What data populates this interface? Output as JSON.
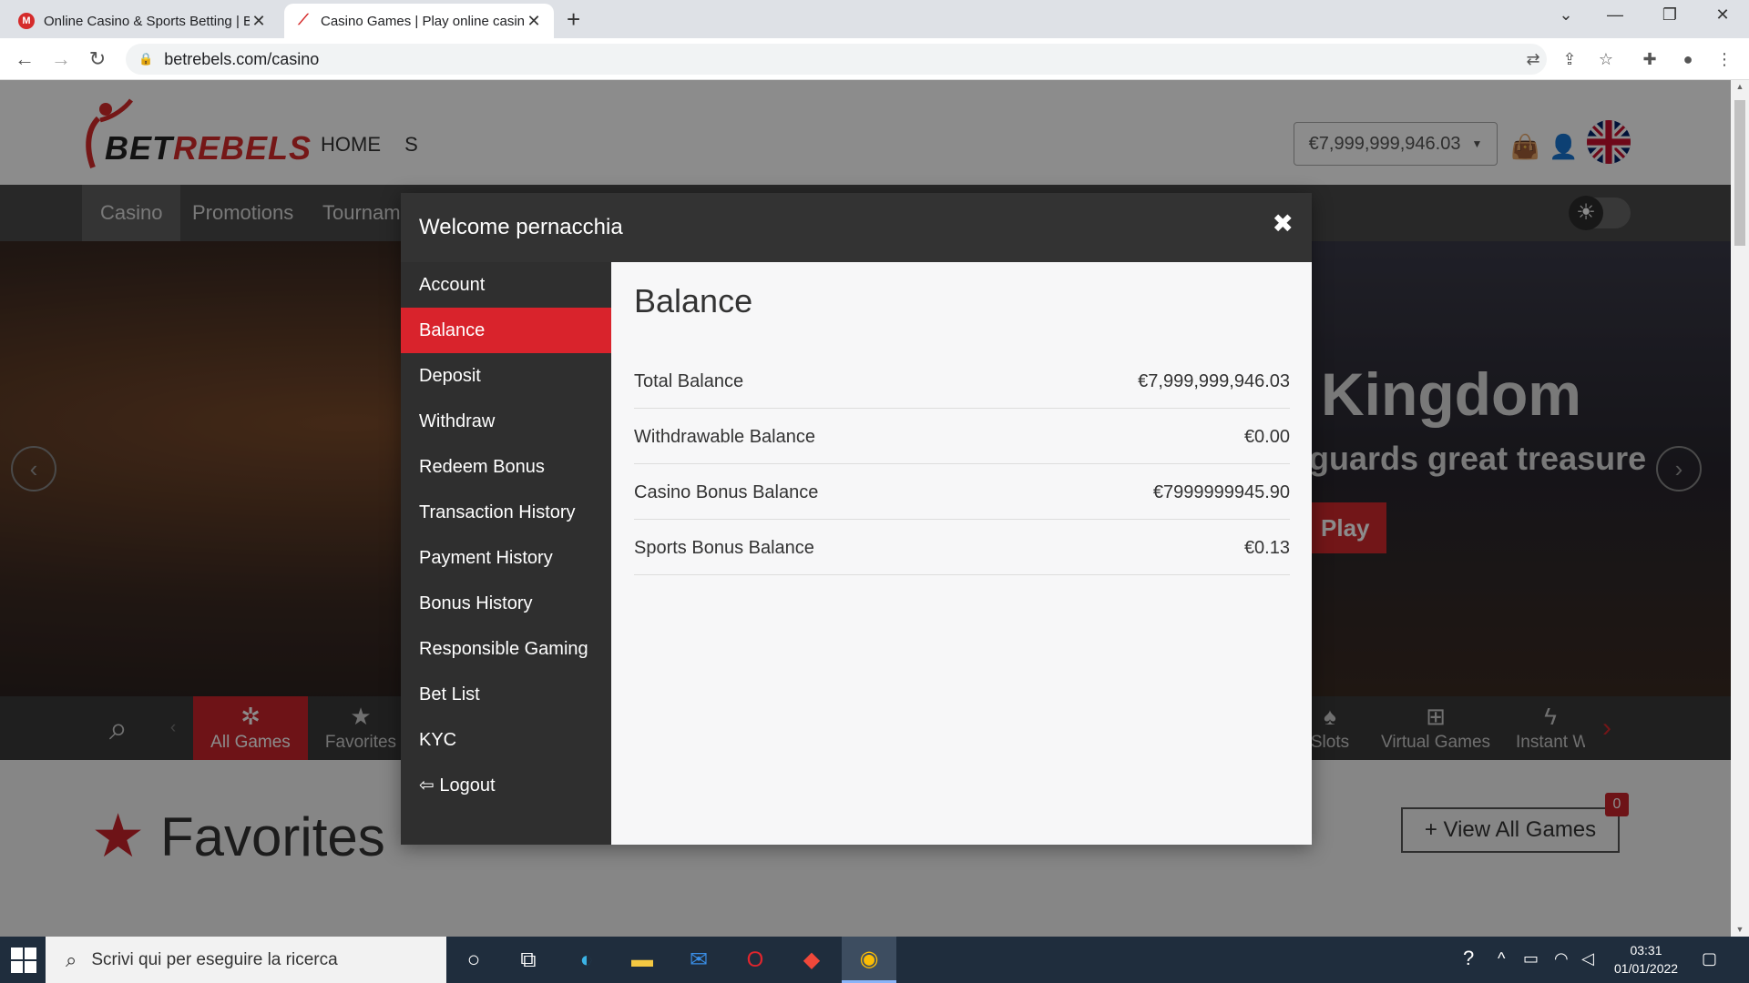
{
  "browser": {
    "tabs": [
      {
        "title": "Online Casino & Sports Betting | BetRebels",
        "active": false
      },
      {
        "title": "Casino Games | Play online casino",
        "active": true
      }
    ],
    "url": "betrebels.com/casino"
  },
  "site": {
    "logo_text_left": "BET",
    "logo_text_right": "REBELS",
    "top_nav": [
      "HOME",
      "S"
    ],
    "balance_pill": "€7,999,999,946.03",
    "subnav": [
      "Casino",
      "Promotions",
      "Tournaments"
    ],
    "hero": {
      "title": "Kingdom",
      "subtitle": "guards great treasure",
      "button": "Play"
    },
    "gamebar": [
      {
        "label": "All Games",
        "icon": "chip-icon"
      },
      {
        "label": "Favorites",
        "icon": "star-icon"
      },
      {
        "label": "Slots",
        "icon": "slots-icon"
      },
      {
        "label": "Virtual Games",
        "icon": "virtual-games-icon"
      },
      {
        "label": "Instant W",
        "icon": "lightning-icon"
      }
    ],
    "favorites_title": "Favorites",
    "view_all_button": "+ View All Games",
    "favorites_count": "0"
  },
  "modal": {
    "title": "Welcome pernacchia",
    "menu": [
      "Account",
      "Balance",
      "Deposit",
      "Withdraw",
      "Redeem Bonus",
      "Transaction History",
      "Payment History",
      "Bonus History",
      "Responsible Gaming",
      "Bet List",
      "KYC",
      "Logout"
    ],
    "active_menu": "Balance",
    "body_title": "Balance",
    "balances": [
      {
        "label": "Total Balance",
        "value": "€7,999,999,946.03"
      },
      {
        "label": "Withdrawable Balance",
        "value": "€0.00"
      },
      {
        "label": "Casino Bonus Balance",
        "value": "€7999999945.90"
      },
      {
        "label": "Sports Bonus Balance",
        "value": "€0.13"
      }
    ]
  },
  "taskbar": {
    "search_placeholder": "Scrivi qui per eseguire la ricerca",
    "time": "03:31",
    "date": "01/01/2022"
  },
  "colors": {
    "accent_red": "#d9232c",
    "modal_header": "#333333",
    "modal_menu": "#2f2f2f"
  }
}
